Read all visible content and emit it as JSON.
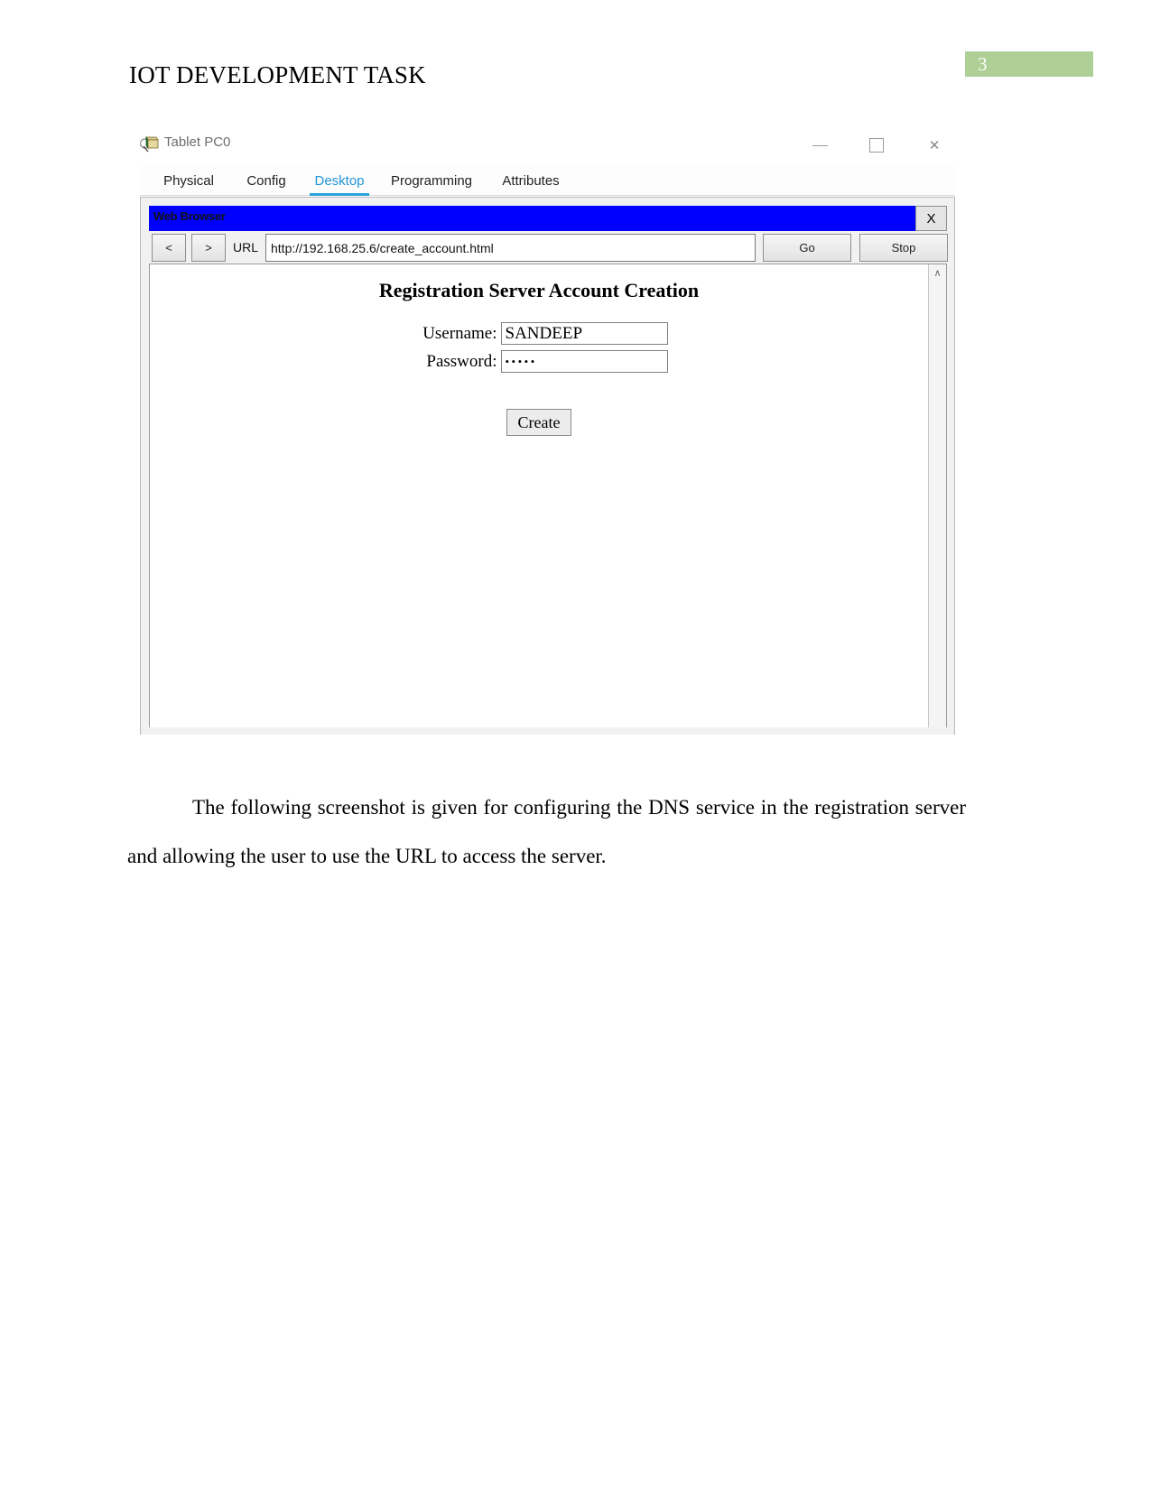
{
  "document": {
    "header_title": "IOT DEVELOPMENT TASK",
    "page_number": "3",
    "page_number_color": "#aecf95",
    "body_paragraph": "The following screenshot is given for configuring the DNS service in the registration server and allowing the user to use the URL to access the server."
  },
  "screenshot": {
    "window": {
      "title": "Tablet PC0",
      "icon": "packet-tracer-device-icon",
      "controls": {
        "minimize": "—",
        "maximize": "□",
        "close": "✕"
      },
      "tabs": [
        {
          "label": "Physical",
          "active": false
        },
        {
          "label": "Config",
          "active": false
        },
        {
          "label": "Desktop",
          "active": true
        },
        {
          "label": "Programming",
          "active": false
        },
        {
          "label": "Attributes",
          "active": false
        }
      ],
      "active_tab_color": "#29a3dd"
    },
    "web_browser": {
      "title": "Web Browser",
      "titlebar_color": "#0000ff",
      "close_label": "X",
      "back_label": "<",
      "forward_label": ">",
      "url_label": "URL",
      "url_value": "http://192.168.25.6/create_account.html",
      "go_label": "Go",
      "stop_label": "Stop",
      "scroll_up_glyph": "∧"
    },
    "page_content": {
      "heading": "Registration Server Account Creation",
      "fields": [
        {
          "label": "Username:",
          "value": "SANDEEP",
          "type": "text"
        },
        {
          "label": "Password:",
          "value": "•••••",
          "type": "password"
        }
      ],
      "submit_label": "Create"
    }
  }
}
